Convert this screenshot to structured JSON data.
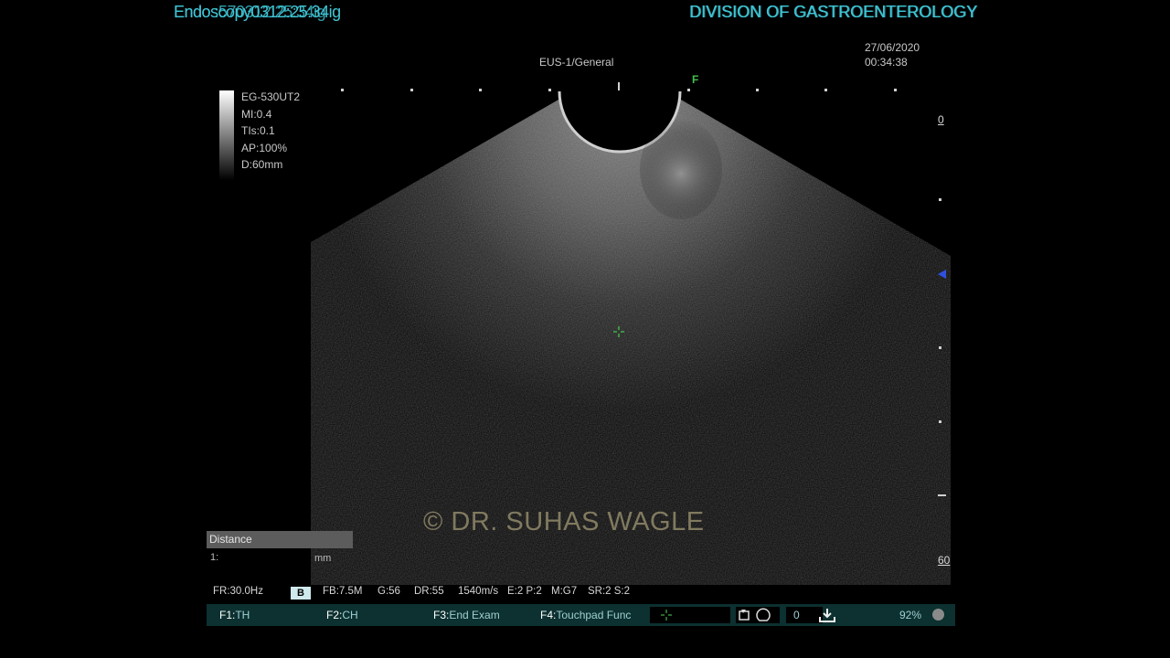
{
  "header": {
    "left_text_a": "Endoscopy0312:25:34ig",
    "left_text_b": "Endo  :570312:25:34ig",
    "right_text_a": "DIVISION OF GASTROENTEROLOGY",
    "right_text_b": "DIVISION OF GASTROENTEROLOGY"
  },
  "datetime": {
    "date": "27/06/2020",
    "time": "00:34:38"
  },
  "mode": "EUS-1/General",
  "focus_marker": "F",
  "params": [
    "EG-530UT2",
    "MI:0.4",
    "TIs:0.1",
    "AP:100%",
    "D:60mm"
  ],
  "depth": {
    "top": "0",
    "bottom": "60"
  },
  "distance": {
    "title": "Distance",
    "value": "1:",
    "unit": "mm"
  },
  "watermark": "© DR. SUHAS WAGLE",
  "status": {
    "fr": "FR:30.0Hz",
    "mode_badge": "B",
    "fb": "FB:7.5M",
    "g": "G:56",
    "dr": "DR:55",
    "speed": "1540m/s",
    "ep": "E:2 P:2",
    "mg": "M:G7",
    "srs": "SR:2 S:2"
  },
  "function_keys": [
    {
      "key": "F1:",
      "label": "TH"
    },
    {
      "key": "F2:",
      "label": "CH"
    },
    {
      "key": "F3:",
      "label": "End Exam"
    },
    {
      "key": "F4:",
      "label": "Touchpad Func"
    }
  ],
  "counter": "0",
  "battery": "92%",
  "colors": {
    "header_cyan": "#3fc6d6",
    "fbar_bg": "#0d3030",
    "watermark": "#8b8466"
  }
}
